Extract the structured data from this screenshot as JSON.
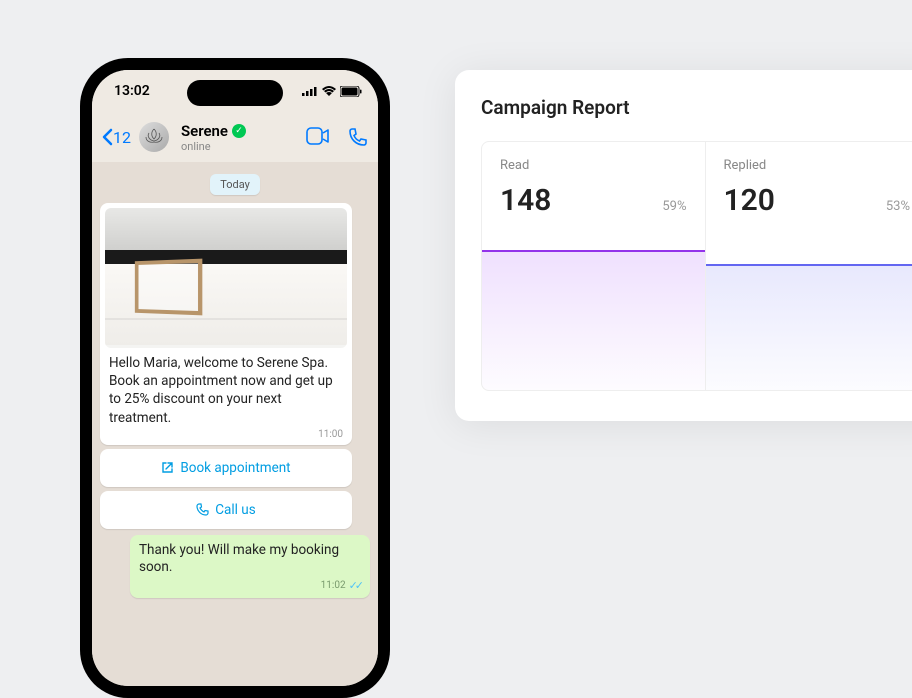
{
  "phone": {
    "status": {
      "time": "13:02"
    },
    "nav": {
      "back_count": "12",
      "contact_name": "Serene",
      "contact_status": "online"
    },
    "chat": {
      "date_label": "Today",
      "message_in": {
        "text": "Hello Maria, welcome to Serene Spa. Book an appointment now and get up to 25% discount on your next treatment.",
        "time": "11:00"
      },
      "actions": {
        "book": "Book appointment",
        "call": "Call us"
      },
      "message_out": {
        "text": "Thank you! Will make my booking soon.",
        "time": "11:02"
      }
    }
  },
  "report": {
    "title": "Campaign Report",
    "metrics": {
      "read": {
        "label": "Read",
        "value": "148",
        "pct": "59%"
      },
      "replied": {
        "label": "Replied",
        "value": "120",
        "pct": "53%"
      }
    }
  }
}
